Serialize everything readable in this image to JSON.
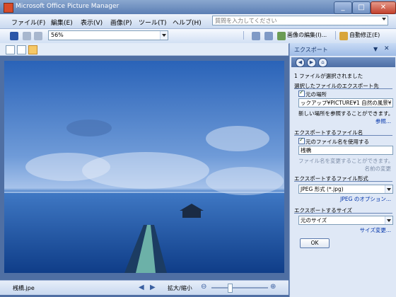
{
  "window": {
    "title": "Microsoft Office Picture Manager"
  },
  "menu": {
    "items": [
      "ファイル(F)",
      "編集(E)",
      "表示(V)",
      "画像(P)",
      "ツール(T)",
      "ヘルプ(H)"
    ],
    "ask_placeholder": "質問を入力してください"
  },
  "toolbar": {
    "zoom_value": "56%",
    "edit_label": "画像の編集(I)...",
    "autofix_label": "自動修正(E)"
  },
  "status": {
    "filename": "桟橋.jpe",
    "zoom_label": "拡大/縮小",
    "zoom_fraction": 0.33
  },
  "pane": {
    "title": "エクスポート",
    "selected_text": "1 ファイルが選択されました",
    "export_dest_title": "選択したファイルのエクスポート先",
    "original_location_label": "元の場所",
    "path_value": "ックアップ¥PICTURE¥1 自然の風景¥",
    "new_location_text": "新しい場所を参照することができます。",
    "browse_link": "参照...",
    "filename_title": "エクスポートするファイル名",
    "use_original_label": "元のファイル名を使用する",
    "name_value": "桟橋",
    "name_hint": "ファイル名を変更することができます。",
    "rename_link": "名前の変更",
    "format_title": "エクスポートするファイル形式",
    "format_value": "JPEG 形式 (*.jpg)",
    "jpeg_options_link": "JPEG のオプション...",
    "size_title": "エクスポートするサイズ",
    "size_value": "元のサイズ",
    "size_change_link": "サイズ変更...",
    "ok_label": "OK"
  }
}
